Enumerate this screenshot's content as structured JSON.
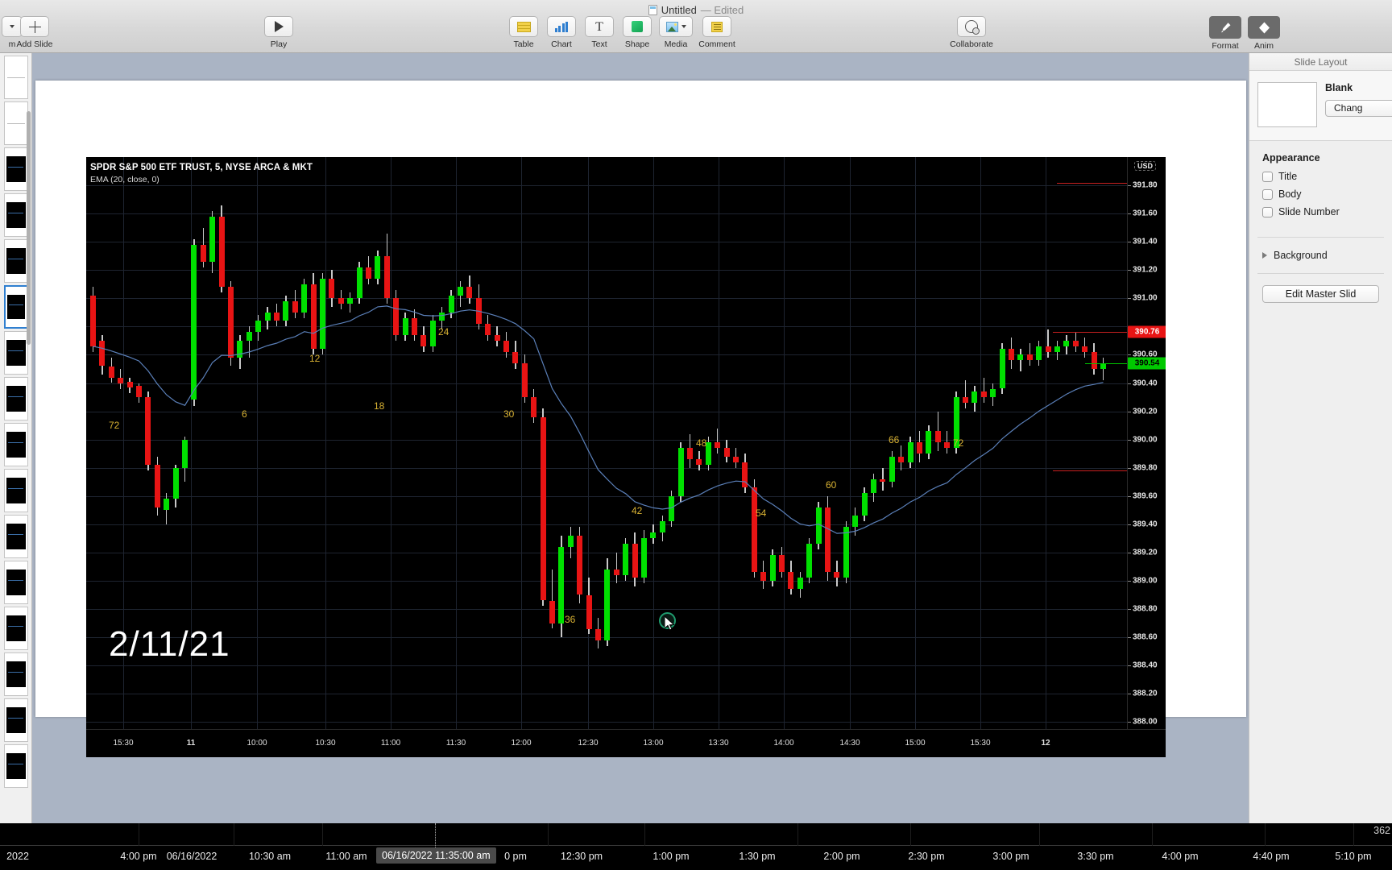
{
  "window": {
    "title": "Untitled",
    "edited_suffix": "— Edited"
  },
  "toolbar": {
    "add_slide": "Add Slide",
    "play": "Play",
    "table": "Table",
    "chart": "Chart",
    "text": "Text",
    "shape": "Shape",
    "media": "Media",
    "comment": "Comment",
    "collaborate": "Collaborate",
    "format": "Format",
    "animate": "Anim"
  },
  "inspector": {
    "header": "Slide Layout",
    "layout_name": "Blank",
    "change_button": "Chang",
    "appearance_title": "Appearance",
    "checkboxes": [
      {
        "label": "Title",
        "checked": false
      },
      {
        "label": "Body",
        "checked": false
      },
      {
        "label": "Slide Number",
        "checked": false
      }
    ],
    "background_label": "Background",
    "edit_master_button": "Edit Master Slid"
  },
  "chart_data": {
    "type": "line",
    "title": "SPDR S&P 500 ETF TRUST, 5, NYSE ARCA & MKT",
    "subtitle": "EMA (20, close, 0)",
    "currency_badge": "USD",
    "date_overlay": "2/11/21",
    "ylabel": "",
    "xlabel": "",
    "ylim": [
      387.95,
      392.0
    ],
    "y_ticks": [
      "391.80",
      "391.60",
      "391.40",
      "391.20",
      "391.00",
      "390.60",
      "390.40",
      "390.20",
      "390.00",
      "389.80",
      "389.60",
      "389.40",
      "389.20",
      "389.00",
      "388.80",
      "388.60",
      "388.40",
      "388.20",
      "388.00"
    ],
    "x_ticks": [
      "15:30",
      "11",
      "10:00",
      "10:30",
      "11:00",
      "11:30",
      "12:00",
      "12:30",
      "13:00",
      "13:30",
      "14:00",
      "14:30",
      "15:00",
      "15:30",
      "12"
    ],
    "price_markers": [
      {
        "value": "390.76",
        "color": "#e81414",
        "style": "red"
      },
      {
        "value": "390.54",
        "color": "#00c800",
        "style": "green"
      }
    ],
    "count_labels": [
      "72",
      "6",
      "12",
      "18",
      "24",
      "30",
      "36",
      "42",
      "48",
      "54",
      "60",
      "66",
      "72"
    ],
    "colors": {
      "up": "#00e000",
      "down": "#e81414",
      "wick": "#c8c8c8",
      "ema": "#5a7fb8",
      "grid": "#1e2430",
      "background": "#000000",
      "label": "#d9b233"
    }
  },
  "timeline": {
    "ticks": [
      "2022",
      "4:00 pm",
      "06/16/2022",
      "10:30 am",
      "11:00 am",
      "0 pm",
      "12:30 pm",
      "1:00 pm",
      "1:30 pm",
      "2:00 pm",
      "2:30 pm",
      "3:00 pm",
      "3:30 pm",
      "4:00 pm",
      "4:40 pm",
      "5:10 pm"
    ],
    "highlight": "06/16/2022 11:35:00 am",
    "corner_value": "362"
  }
}
